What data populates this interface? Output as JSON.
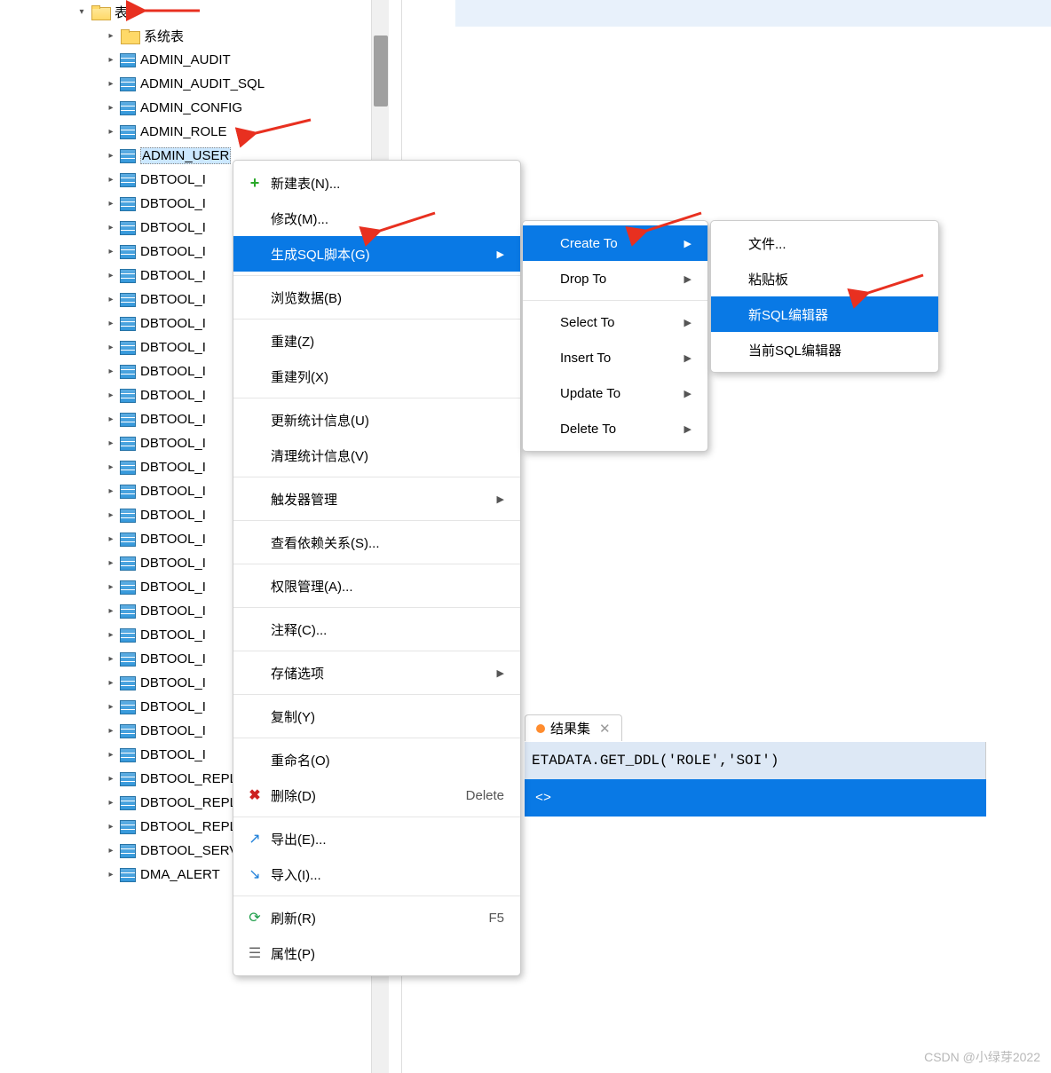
{
  "tree": {
    "root": "表",
    "subfolder": "系统表",
    "items": [
      "ADMIN_AUDIT",
      "ADMIN_AUDIT_SQL",
      "ADMIN_CONFIG",
      "ADMIN_ROLE",
      "ADMIN_USER",
      "DBTOOL_I",
      "DBTOOL_I",
      "DBTOOL_I",
      "DBTOOL_I",
      "DBTOOL_I",
      "DBTOOL_I",
      "DBTOOL_I",
      "DBTOOL_I",
      "DBTOOL_I",
      "DBTOOL_I",
      "DBTOOL_I",
      "DBTOOL_I",
      "DBTOOL_I",
      "DBTOOL_I",
      "DBTOOL_I",
      "DBTOOL_I",
      "DBTOOL_I",
      "DBTOOL_I",
      "DBTOOL_I",
      "DBTOOL_I",
      "DBTOOL_I",
      "DBTOOL_I",
      "DBTOOL_I",
      "DBTOOL_I",
      "DBTOOL_I",
      "DBTOOL_REPLACE",
      "DBTOOL_REPLACE_EXECUTE",
      "DBTOOL_REPLACE_EXECUTE_",
      "DBTOOL_SERVER_CONN",
      "DMA_ALERT"
    ],
    "selected_index": 4
  },
  "menu1": {
    "new_table": "新建表(N)...",
    "modify": "修改(M)...",
    "gen_sql": "生成SQL脚本(G)",
    "browse": "浏览数据(B)",
    "rebuild": "重建(Z)",
    "rebuild_col": "重建列(X)",
    "update_stats": "更新统计信息(U)",
    "clear_stats": "清理统计信息(V)",
    "trigger_mgmt": "触发器管理",
    "view_deps": "查看依赖关系(S)...",
    "perm_mgmt": "权限管理(A)...",
    "comment": "注释(C)...",
    "storage": "存储选项",
    "copy": "复制(Y)",
    "rename": "重命名(O)",
    "delete": "删除(D)",
    "delete_key": "Delete",
    "export": "导出(E)...",
    "import": "导入(I)...",
    "refresh": "刷新(R)",
    "refresh_key": "F5",
    "properties": "属性(P)"
  },
  "menu2": {
    "create_to": "Create To",
    "drop_to": "Drop To",
    "select_to": "Select To",
    "insert_to": "Insert To",
    "update_to": "Update To",
    "delete_to": "Delete To"
  },
  "menu3": {
    "file": "文件...",
    "clipboard": "粘贴板",
    "new_sql": "新SQL编辑器",
    "current_sql": "当前SQL编辑器"
  },
  "result": {
    "tab_label": "结果集",
    "sql_text": "ETADATA.GET_DDL('ROLE','SOI')",
    "body_text": "<>"
  },
  "watermark": "CSDN @小绿芽2022"
}
